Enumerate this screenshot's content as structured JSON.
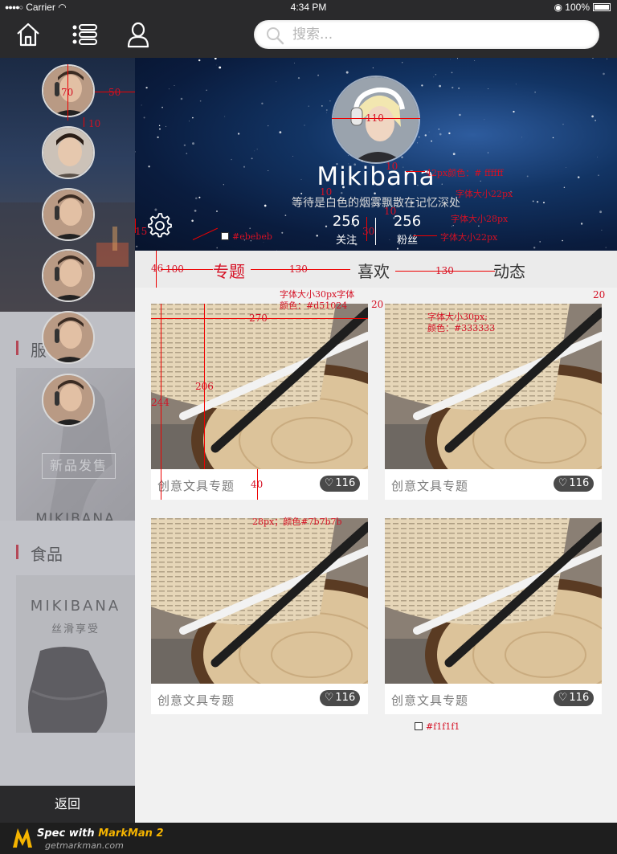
{
  "status_bar": {
    "carrier": "Carrier",
    "time": "4:34 PM",
    "battery": "100%"
  },
  "navbar": {
    "search_placeholder": "搜索..."
  },
  "drawer": {
    "sections": [
      {
        "title": "服",
        "card_tag": "新品发售",
        "card_brand": "MIKIBANA"
      },
      {
        "title": "食品",
        "card_brand": "MIKIBANA",
        "card_sub": "丝滑享受"
      }
    ],
    "return_label": "返回"
  },
  "profile": {
    "name": "Mikibana",
    "slogan": "等待是白色的烟雾飘散在记忆深处",
    "following_count": "256",
    "following_label": "关注",
    "fans_count": "256",
    "fans_label": "粉丝"
  },
  "tabs": [
    "专题",
    "喜欢",
    "动态"
  ],
  "cards": [
    {
      "title": "创意文具专题",
      "likes": "116"
    },
    {
      "title": "创意文具专题",
      "likes": "116"
    },
    {
      "title": "创意文具专题",
      "likes": "116"
    },
    {
      "title": "创意文具专题",
      "likes": "116"
    }
  ],
  "annotations": {
    "a70": "70",
    "a50": "50",
    "a10a": "10",
    "a110": "110",
    "a10b": "10",
    "name_spec": "42px颜色：# ffffff",
    "a10c": "10",
    "slogan_spec": "字体大小22px",
    "a10d": "10",
    "count_spec": "字体大小28px",
    "a30": "30",
    "label_spec": "字体大小22px",
    "a15": "15",
    "bg_spec": "#ebebeb",
    "a46": "46",
    "a100": "100",
    "a130a": "130",
    "a130b": "130",
    "tab_spec_1": "字体大小30px字体",
    "tab_spec_2": "颜色：#d51024",
    "tab2_spec_1": "字体大小30px;",
    "tab2_spec_2": "颜色：#333333",
    "a20a": "20",
    "a20b": "20",
    "a270": "270",
    "a206": "206",
    "a244": "244",
    "a40": "40",
    "title_spec": "28px；颜色#7b7b7b",
    "page_bg_spec": "#f1f1f1"
  },
  "footer": {
    "brand_prefix": "Spec with ",
    "brand_name": "MarkMan 2",
    "url": "getmarkman.com"
  },
  "colors": {
    "accent": "#d51024",
    "tab_bg": "#ebebeb",
    "page_bg": "#f1f1f1",
    "card_title": "#7b7b7b"
  }
}
